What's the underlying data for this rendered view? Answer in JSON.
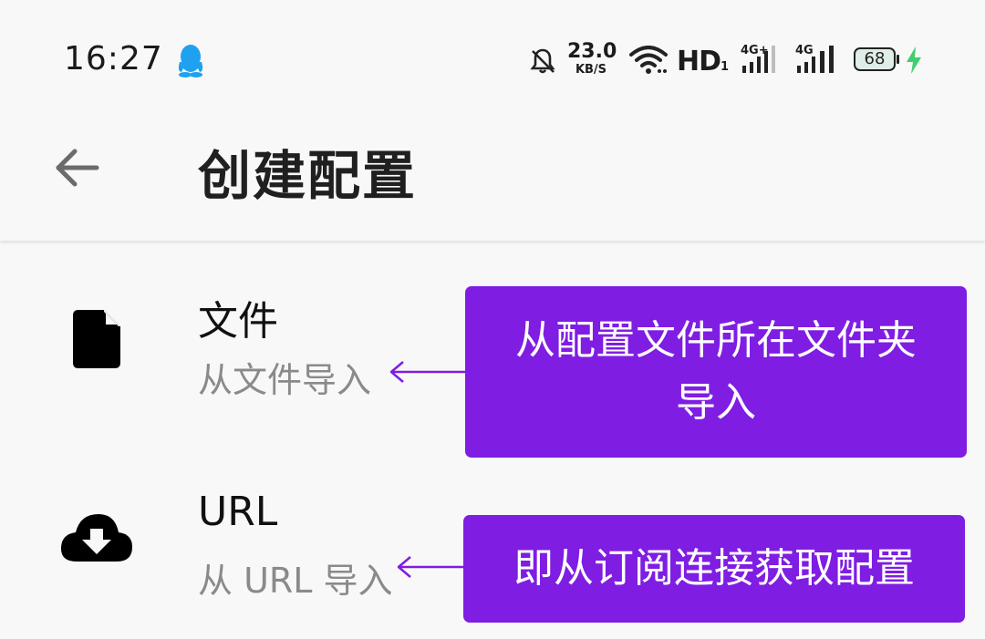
{
  "status_bar": {
    "time": "16:27",
    "net_speed_value": "23.0",
    "net_speed_unit": "KB/S",
    "hd_label": "HD",
    "hd_sub": "1",
    "sim1_label": "4G+",
    "sim2_label": "4G",
    "battery_level": "68",
    "icons": [
      "qq-icon",
      "mute-bell-icon",
      "wifi-icon",
      "signal-icon",
      "battery-icon",
      "charging-bolt-icon"
    ]
  },
  "app_bar": {
    "title": "创建配置",
    "back_icon": "arrow-left-icon"
  },
  "items": [
    {
      "title": "文件",
      "subtitle": "从文件导入",
      "icon": "file-icon"
    },
    {
      "title": "URL",
      "subtitle": "从 URL 导入",
      "icon": "cloud-download-icon"
    }
  ],
  "annotations": [
    {
      "line1": "从配置文件所在文件夹",
      "line2": "导入"
    },
    {
      "line1": "即从订阅连接获取配置"
    }
  ],
  "colors": {
    "callout_bg": "#7f1de3",
    "qq_blue": "#1ea2f0",
    "charging_green": "#3fcf6b",
    "background": "#f8f8f8"
  }
}
